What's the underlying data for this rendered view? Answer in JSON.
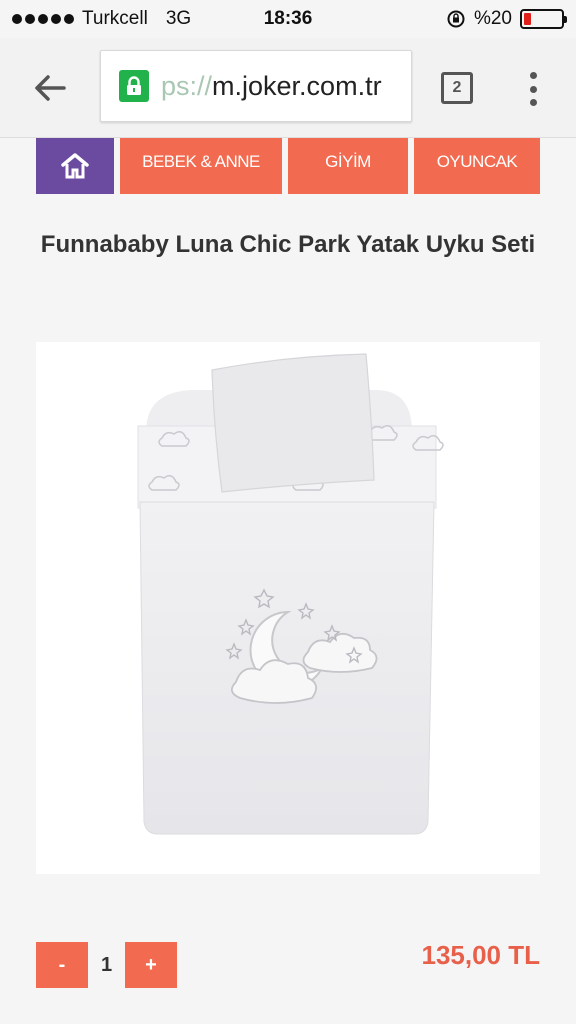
{
  "status_bar": {
    "carrier": "Turkcell",
    "network": "3G",
    "time": "18:36",
    "battery": "%20",
    "battery_level": 0.2,
    "battery_color": "#e0201b"
  },
  "browser": {
    "url_scheme": "ps://",
    "url_host": "m.joker.com.tr",
    "tab_count": "2",
    "lock_color": "#22b24c"
  },
  "nav": {
    "home_color": "#6b4ba0",
    "accent_color": "#f26a4f",
    "items": [
      {
        "label": "BEBEK & ANNE"
      },
      {
        "label": "GİYİM"
      },
      {
        "label": "OYUNCAK"
      }
    ]
  },
  "product": {
    "title": "Funnababy Luna Chic Park Yatak Uyku Seti",
    "quantity": "1",
    "minus_label": "-",
    "plus_label": "+",
    "price": "135,00 TL",
    "price_color": "#e8604a"
  }
}
